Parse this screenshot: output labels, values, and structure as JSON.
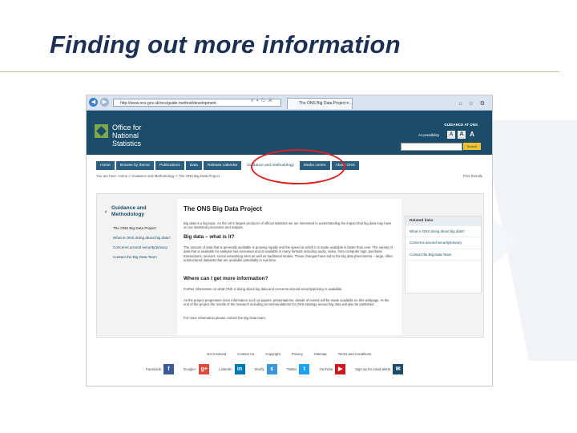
{
  "slide": {
    "title": "Finding out more information"
  },
  "browser": {
    "url": "http://www.ons.gov.uk/ons/guide-method/development",
    "tab_title": "The ONS Big Data Project - ..."
  },
  "site": {
    "org_name": "Office for National Statistics",
    "top_link": "GUIDANCE AT ONS",
    "accessibility_label": "Accessibility",
    "text_sizes": [
      "A",
      "A",
      "A"
    ],
    "search_button": "Search",
    "menu": [
      "Home",
      "Browse by theme",
      "Publications",
      "Data",
      "Release calendar",
      "Guidance and methodology",
      "Media centre",
      "About ONS"
    ],
    "menu_selected_index": 5,
    "breadcrumb": "You are here: Home > Guidance and Methodology > The ONS Big Data Project",
    "print_link": "Print friendly"
  },
  "sidebar": {
    "heading": "Guidance and Methodology",
    "items": [
      "The ONS Big Data Project",
      "What is ONS doing about big data?",
      "Concerns around security/privacy",
      "Contact the Big Data Team"
    ]
  },
  "article": {
    "title": "The ONS Big Data Project",
    "intro": "Big data is a big topic. As the UK's largest producer of official statistics we are interested in understanding the impact that big data may have on our statistical processes and outputs.",
    "h_what": "Big data – what is it?",
    "what_text": "The amount of data that is generally available is growing rapidly and the speed at which it is made available is faster than ever. The variety of data that is available for analysis has increased and is available in many formats including audio, video, from computer logs, purchase transactions, sensors, social networking sites as well as traditional modes. These changes have led to the big data phenomena – large, often unstructured datasets that are available potentially in real time.",
    "h_where": "Where can I get more information?",
    "where_text": "Further information on what ONS is doing about big data and concerns around security/privacy is available.",
    "where_text2": "As the project progresses more information such as papers, presentations, details of events will be made available on this webpage. At the end of the project the results of the research including recommendations for ONS strategy around big data will also be published.",
    "contact_text": "For more information please contact the Big Data team."
  },
  "related": {
    "heading": "Related links",
    "items": [
      "What is ONS doing about big data?",
      "Concerns around security/privacy",
      "Contact the Big Data Team"
    ]
  },
  "footer": {
    "links": [
      "Get Involved",
      "Contact Us",
      "Copyright",
      "Privacy",
      "Sitemap",
      "Terms and Conditions"
    ],
    "social": [
      {
        "label": "Facebook",
        "icon": "facebook-icon",
        "glyph": "f",
        "color": "#3b5998"
      },
      {
        "label": "Google+",
        "icon": "google-plus-icon",
        "glyph": "g+",
        "color": "#dd4b39"
      },
      {
        "label": "LinkedIn",
        "icon": "linkedin-icon",
        "glyph": "in",
        "color": "#0077b5"
      },
      {
        "label": "Storify",
        "icon": "storify-icon",
        "glyph": "s",
        "color": "#3a98d9"
      },
      {
        "label": "Twitter",
        "icon": "twitter-icon",
        "glyph": "t",
        "color": "#1da1f2"
      },
      {
        "label": "YouTube",
        "icon": "youtube-icon",
        "glyph": "▶",
        "color": "#cc181e"
      },
      {
        "label": "Sign up for email alerts",
        "icon": "email-alert-icon",
        "glyph": "✉",
        "color": "#1b4d6b"
      }
    ]
  },
  "colors": {
    "header_bg": "#1b4d6b",
    "highlight": "#d81f1f",
    "title": "#1c2f55",
    "logo_green": "#7fa84a"
  }
}
